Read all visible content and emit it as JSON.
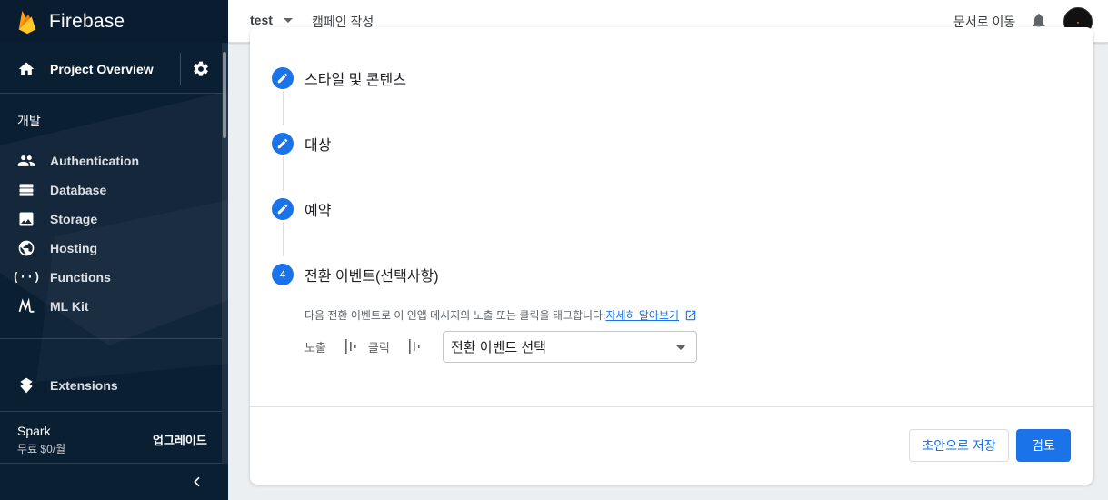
{
  "brand": {
    "name": "Firebase"
  },
  "sidebar": {
    "project_overview_label": "Project Overview",
    "section_title": "개발",
    "items": [
      {
        "label": "Authentication",
        "icon": "people-icon"
      },
      {
        "label": "Database",
        "icon": "database-icon"
      },
      {
        "label": "Storage",
        "icon": "image-icon"
      },
      {
        "label": "Hosting",
        "icon": "globe-icon"
      },
      {
        "label": "Functions",
        "icon": "functions-icon"
      },
      {
        "label": "ML Kit",
        "icon": "ml-kit-icon"
      }
    ],
    "extensions_label": "Extensions",
    "plan": {
      "name": "Spark",
      "price": "무료 $0/월",
      "upgrade_label": "업그레이드"
    }
  },
  "topbar": {
    "project": "test",
    "page": "캠페인 작성",
    "docs_label": "문서로 이동"
  },
  "steps": [
    {
      "label": "스타일 및 콘텐츠",
      "state": "edit"
    },
    {
      "label": "대상",
      "state": "edit"
    },
    {
      "label": "예약",
      "state": "edit"
    },
    {
      "label": "전환 이벤트(선택사항)",
      "number": "4",
      "state": "active"
    }
  ],
  "conversion": {
    "helper_text": "다음 전환 이벤트로 이 인앱 메시지의 노출 또는 클릭을 태그합니다.",
    "learn_more": "자세히 알아보기",
    "impression_label": "노출",
    "click_label": "클릭",
    "select_value": "전환 이벤트 선택"
  },
  "buttons": {
    "save_draft": "초안으로 저장",
    "review": "검토"
  },
  "colors": {
    "accent": "#1a73e8",
    "sidebar_bg": "#0b1f33",
    "firebase_amber": "#ffa000"
  }
}
